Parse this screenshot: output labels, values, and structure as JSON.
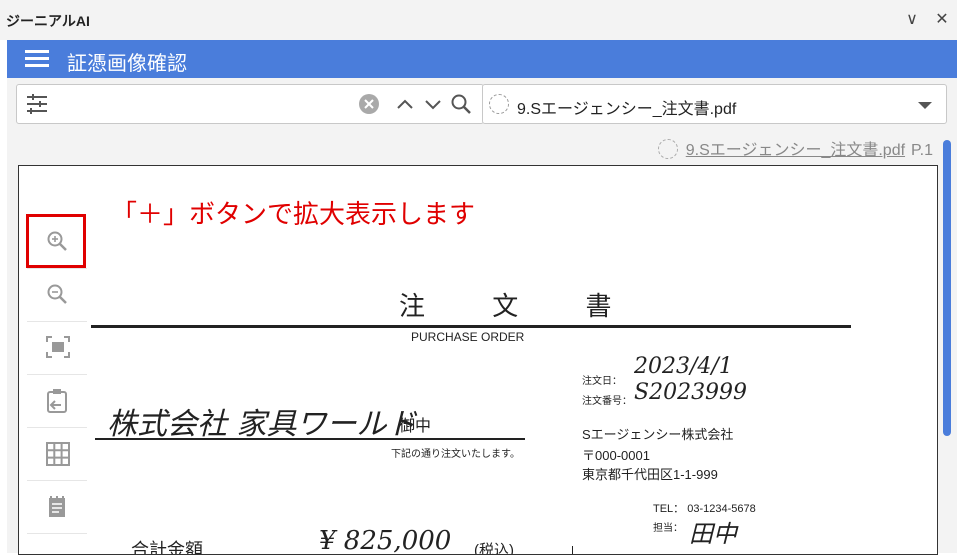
{
  "app": {
    "title": "ジーニアルAI"
  },
  "window_controls": {
    "collapse": "∨",
    "close": "✕"
  },
  "header": {
    "title": "証憑画像確認"
  },
  "toolbar": {
    "search_value": "",
    "search_placeholder": "",
    "file_selected": "9.Sエージェンシー_注文書.pdf"
  },
  "viewer": {
    "file_label": "9.Sエージェンシー_注文書.pdf",
    "page_label": "P.1",
    "annotation": "「＋」ボタンで拡大表示します",
    "zoom_tools": [
      "zoom-in-icon",
      "zoom-out-icon",
      "fit-page-icon",
      "paste-icon",
      "grid-icon",
      "notepad-icon"
    ]
  },
  "document": {
    "title": "注 文 書",
    "subtitle": "PURCHASE ORDER",
    "to_company": "株式会社 家具ワールド",
    "to_suffix": "御中",
    "note": "下記の通り注文いたします。",
    "order_date_label": "注文日：",
    "order_date": "2023/4/1",
    "order_no_label": "注文番号：",
    "order_no": "S2023999",
    "issuer_name": "Sエージェンシー株式会社",
    "issuer_zip": "〒000-0001",
    "issuer_address": "東京都千代田区1-1-999",
    "tel": "TEL：  03-1234-5678",
    "person_label": "担当：",
    "person": "田中",
    "total_label": "合計金額",
    "total_amount": "¥ 825,000",
    "tax_note": "(税込)"
  },
  "colors": {
    "accent": "#4a7ddb",
    "annotation": "#e00000",
    "chrome": "#f3f3f3"
  }
}
